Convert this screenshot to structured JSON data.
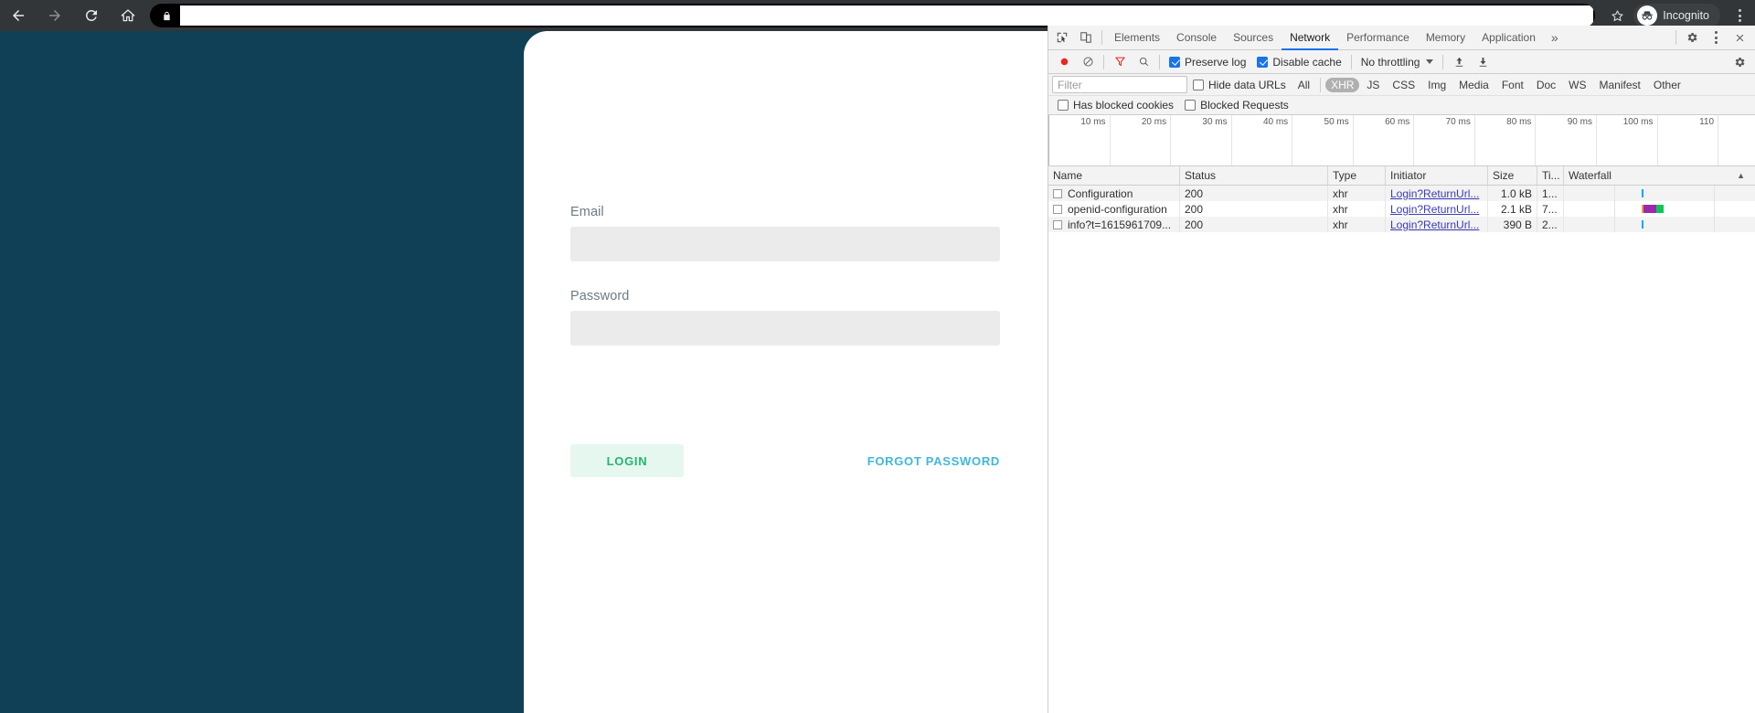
{
  "browser": {
    "back_icon": "arrow-left-icon",
    "forward_icon": "arrow-right-icon",
    "reload_icon": "reload-icon",
    "home_icon": "home-icon",
    "lock_icon": "lock-icon",
    "omnibox_value": "",
    "omnibox_placeholder": "",
    "star_icon": "star-icon",
    "incognito_label": "Incognito",
    "incognito_icon": "incognito-icon",
    "menu_icon": "three-dot-menu-icon",
    "colors": {
      "toolbar_bg": "#323639",
      "omnibox_bg": "#000000"
    }
  },
  "login_page": {
    "background_color": "#104055",
    "card_background": "#ffffff",
    "email_label": "Email",
    "email_value": "",
    "email_placeholder": "",
    "password_label": "Password",
    "password_value": "",
    "password_placeholder": "",
    "login_button": "LOGIN",
    "forgot_password": "FORGOT PASSWORD",
    "colors": {
      "login_text": "#21b573",
      "login_bg": "#e6f7ef",
      "link": "#40b8d8",
      "label": "#6d7b86",
      "input_bg": "#ebebeb"
    }
  },
  "devtools": {
    "inspect_icon": "inspect-element-icon",
    "device_toolbar_icon": "device-toolbar-icon",
    "tabs": [
      {
        "label": "Elements",
        "active": false
      },
      {
        "label": "Console",
        "active": false
      },
      {
        "label": "Sources",
        "active": false
      },
      {
        "label": "Network",
        "active": true
      },
      {
        "label": "Performance",
        "active": false
      },
      {
        "label": "Memory",
        "active": false
      },
      {
        "label": "Application",
        "active": false
      }
    ],
    "more_tabs": "»",
    "settings_icon": "gear-icon",
    "kebab_icon": "three-dot-menu-icon",
    "close_icon": "close-icon",
    "network": {
      "record_icon": "record-button-icon",
      "clear_icon": "clear-icon",
      "filter_icon": "filter-funnel-icon",
      "search_icon": "search-icon",
      "preserve_log": {
        "label": "Preserve log",
        "checked": true
      },
      "disable_cache": {
        "label": "Disable cache",
        "checked": true
      },
      "throttling": "No throttling",
      "import_icon": "import-har-icon",
      "export_icon": "export-har-icon",
      "panel_settings_icon": "gear-icon",
      "filter_placeholder": "Filter",
      "filter_value": "",
      "hide_data_urls": {
        "label": "Hide data URLs",
        "checked": false
      },
      "type_filters": [
        {
          "label": "All",
          "active": false
        },
        {
          "label": "XHR",
          "active": true
        },
        {
          "label": "JS",
          "active": false
        },
        {
          "label": "CSS",
          "active": false
        },
        {
          "label": "Img",
          "active": false
        },
        {
          "label": "Media",
          "active": false
        },
        {
          "label": "Font",
          "active": false
        },
        {
          "label": "Doc",
          "active": false
        },
        {
          "label": "WS",
          "active": false
        },
        {
          "label": "Manifest",
          "active": false
        },
        {
          "label": "Other",
          "active": false
        }
      ],
      "has_blocked_cookies": {
        "label": "Has blocked cookies",
        "checked": false
      },
      "blocked_requests": {
        "label": "Blocked Requests",
        "checked": false
      },
      "overview_ticks": [
        "10 ms",
        "20 ms",
        "30 ms",
        "40 ms",
        "50 ms",
        "60 ms",
        "70 ms",
        "80 ms",
        "90 ms",
        "100 ms",
        "110"
      ],
      "columns": [
        "Name",
        "Status",
        "Type",
        "Initiator",
        "Size",
        "Ti...",
        "Waterfall"
      ],
      "sort_arrow": "▲",
      "rows": [
        {
          "name": "Configuration",
          "status": "200",
          "type": "xhr",
          "initiator": "Login?ReturnUrl...",
          "size": "1.0 kB",
          "time": "1...",
          "waterfall": {
            "left_pct": 40.5,
            "width_pct": 0.6,
            "color": "#00a8ff",
            "segments": []
          }
        },
        {
          "name": "openid-configuration",
          "status": "200",
          "type": "xhr",
          "initiator": "Login?ReturnUrl...",
          "size": "2.1 kB",
          "time": "7...",
          "waterfall": {
            "left_pct": 40.5,
            "width_pct": 11.5,
            "segments": [
              {
                "color": "#e6a23c",
                "width_pct": 1.2
              },
              {
                "color": "#9c27b0",
                "width_pct": 6.8
              },
              {
                "color": "#0ac850",
                "width_pct": 3.5
              }
            ]
          }
        },
        {
          "name": "info?t=1615961709...",
          "status": "200",
          "type": "xhr",
          "initiator": "Login?ReturnUrl...",
          "size": "390 B",
          "time": "2...",
          "waterfall": {
            "left_pct": 40.5,
            "width_pct": 0.6,
            "color": "#00a8ff",
            "segments": []
          }
        }
      ]
    }
  }
}
